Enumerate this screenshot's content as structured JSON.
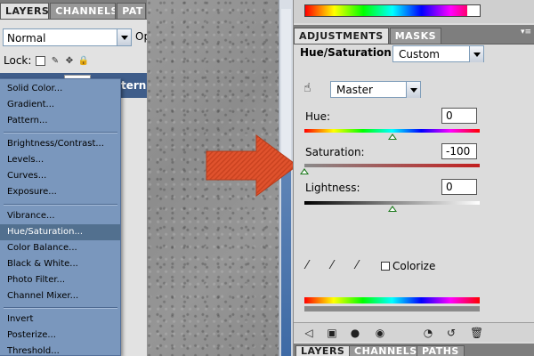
{
  "layers_panel": {
    "tabs": [
      "LAYERS",
      "CHANNELS",
      "PAT"
    ],
    "blend_mode": "Normal",
    "opacity_label": "Op",
    "lock_label": "Lock:",
    "layer_label": "tern l"
  },
  "adjustment_menu": {
    "items": [
      "Solid Color...",
      "Gradient...",
      "Pattern...",
      "Brightness/Contrast...",
      "Levels...",
      "Curves...",
      "Exposure...",
      "Vibrance...",
      "Hue/Saturation...",
      "Color Balance...",
      "Black & White...",
      "Photo Filter...",
      "Channel Mixer...",
      "Invert",
      "Posterize...",
      "Threshold..."
    ],
    "selected": "Hue/Saturation..."
  },
  "adjustments_panel": {
    "tabs": [
      "ADJUSTMENTS",
      "MASKS"
    ],
    "menu_glyph": "▾≡",
    "title": "Hue/Saturation",
    "preset": "Custom",
    "channel": "Master",
    "hue": {
      "label": "Hue:",
      "value": "0",
      "fraction": 0.5
    },
    "saturation": {
      "label": "Saturation:",
      "value": "-100",
      "fraction": 0.0
    },
    "lightness": {
      "label": "Lightness:",
      "value": "0",
      "fraction": 0.5
    },
    "colorize_label": "Colorize",
    "bottom_tabs": [
      "LAYERS",
      "CHANNELS",
      "PATHS"
    ]
  },
  "colors": {
    "arrow": "#e0522d",
    "menu_bg": "#7a97bd",
    "menu_selected": "#52708f"
  }
}
